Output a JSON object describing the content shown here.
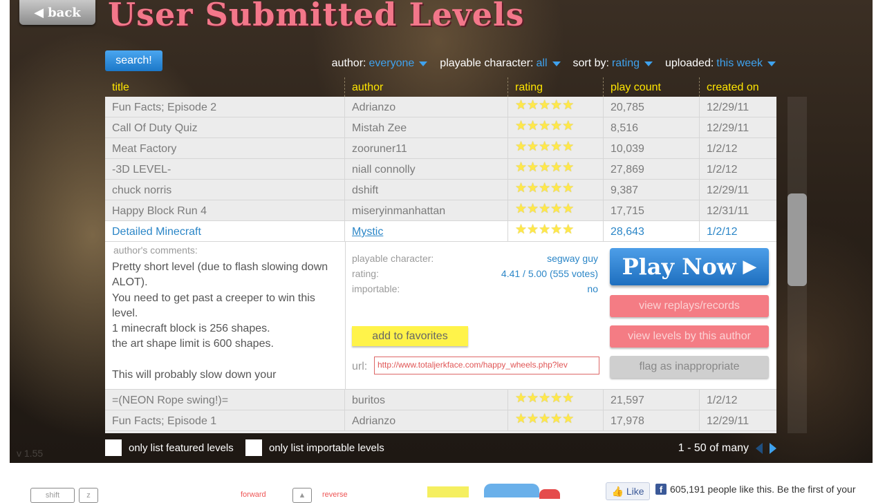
{
  "header": {
    "back_label": "back",
    "title": "User Submitted Levels",
    "search_label": "search!"
  },
  "filters": {
    "author": {
      "label": "author:",
      "value": "everyone"
    },
    "character": {
      "label": "playable character:",
      "value": "all"
    },
    "sort": {
      "label": "sort by:",
      "value": "rating"
    },
    "uploaded": {
      "label": "uploaded:",
      "value": "this week"
    }
  },
  "columns": [
    "title",
    "author",
    "rating",
    "play count",
    "created on"
  ],
  "rows_top": [
    {
      "title": "Fun Facts; Episode 2",
      "author": "Adrianzo",
      "stars": 4.5,
      "plays": "20,785",
      "created": "12/29/11"
    },
    {
      "title": "Call Of Duty Quiz",
      "author": "Mistah Zee",
      "stars": 4.5,
      "plays": "8,516",
      "created": "12/29/11"
    },
    {
      "title": "Meat Factory",
      "author": "zooruner11",
      "stars": 4.5,
      "plays": "10,039",
      "created": "1/2/12"
    },
    {
      "title": "-3D LEVEL-",
      "author": "niall connolly",
      "stars": 4.5,
      "plays": "27,869",
      "created": "1/2/12"
    },
    {
      "title": "chuck norris",
      "author": "dshift",
      "stars": 4.5,
      "plays": "9,387",
      "created": "12/29/11"
    },
    {
      "title": "Happy Block Run 4",
      "author": "miseryinmanhattan",
      "stars": 4.5,
      "plays": "17,715",
      "created": "12/31/11"
    }
  ],
  "selected": {
    "title": "Detailed Minecraft",
    "author": "Mystic",
    "stars": 4.5,
    "plays": "28,643",
    "created": "1/2/12",
    "comments_label": "author's comments:",
    "comments": "Pretty short level (due to flash slowing down ALOT).\nYou need to get past a creeper to win this level.\n1 minecraft block is 256 shapes.\nthe art shape limit is 600 shapes.\n\nThis will probably slow down your",
    "character_label": "playable character:",
    "character_value": "segway guy",
    "rating_label": "rating:",
    "rating_value": "4.41 / 5.00 (555 votes)",
    "importable_label": "importable:",
    "importable_value": "no",
    "favorites_label": "add to favorites",
    "url_label": "url:",
    "url_value": "http://www.totaljerkface.com/happy_wheels.php?lev",
    "play_label": "Play Now",
    "replays_label": "view replays/records",
    "author_levels_label": "view levels by this author",
    "flag_label": "flag as inappropriate"
  },
  "rows_bottom": [
    {
      "title": "=(NEON Rope swing!)=",
      "author": "buritos",
      "stars": 4.5,
      "plays": "21,597",
      "created": "1/2/12"
    },
    {
      "title": "Fun Facts; Episode 1",
      "author": "Adrianzo",
      "stars": 4.5,
      "plays": "17,978",
      "created": "12/29/11"
    }
  ],
  "options": {
    "featured_label": "only list featured levels",
    "importable_label": "only list importable levels"
  },
  "paging": {
    "label": "1 - 50 of many"
  },
  "version": "v 1.55",
  "colors": {
    "accent_blue": "#3fa2ee",
    "title_pink": "#f3778a",
    "header_yellow": "#ffe600"
  },
  "footer": {
    "shift_key": "shift",
    "z_key": "z",
    "forward_label": "forward",
    "reverse_label": "reverse",
    "like_label": "Like",
    "fb_text": "605,191 people like this. Be the first of your"
  }
}
